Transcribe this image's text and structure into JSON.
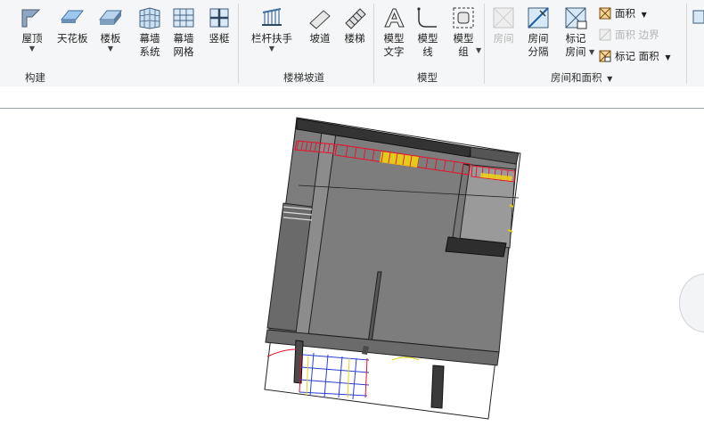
{
  "ribbon": {
    "build_group": {
      "label": "构建",
      "tools": [
        {
          "label": "屋顶",
          "has_dropdown": true
        },
        {
          "label": "天花板",
          "has_dropdown": false
        },
        {
          "label": "楼板",
          "has_dropdown": true
        },
        {
          "label": "幕墙\n系统",
          "has_dropdown": false
        },
        {
          "label": "幕墙\n网格",
          "has_dropdown": false
        },
        {
          "label": "竖梃",
          "has_dropdown": false
        }
      ]
    },
    "stairs_group": {
      "label": "楼梯坡道",
      "tools": [
        {
          "label": "栏杆扶手",
          "has_dropdown": true
        },
        {
          "label": "坡道",
          "has_dropdown": false
        },
        {
          "label": "楼梯",
          "has_dropdown": false
        }
      ]
    },
    "model_group": {
      "label": "模型",
      "tools": [
        {
          "label": "模型\n文字",
          "has_dropdown": false
        },
        {
          "label": "模型\n线",
          "has_dropdown": false
        },
        {
          "label": "模型\n组",
          "has_dropdown": true
        }
      ]
    },
    "room_group": {
      "label": "房间和面积",
      "tools": [
        {
          "label": "房间",
          "disabled": true
        },
        {
          "label": "房间\n分隔",
          "disabled": false
        },
        {
          "label": "标记\n房间",
          "disabled": false
        }
      ],
      "small_items": [
        {
          "label": "面积",
          "disabled": false,
          "has_dropdown": true
        },
        {
          "label": "面积  边界",
          "disabled": true
        },
        {
          "label": "标记  面积",
          "disabled": false,
          "has_dropdown": true
        }
      ]
    }
  },
  "colors": {
    "ribbon_bg": "#f5f6f7",
    "model_gray": "#7a7a7a",
    "model_dark": "#3a3a3a",
    "railing_red": "#e8102a",
    "railing_yellow": "#f5d80a"
  }
}
